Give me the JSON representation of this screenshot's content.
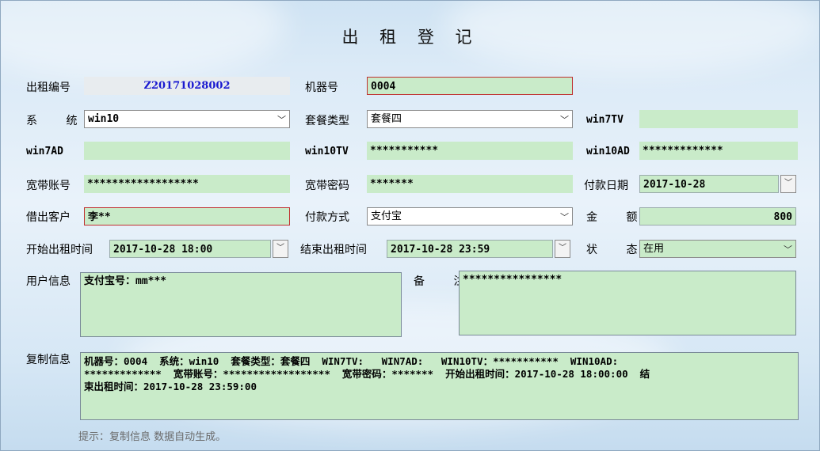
{
  "title": "出 租 登 记",
  "labels": {
    "rental_no": "出租编号",
    "machine_no": "机器号",
    "system": "系 统",
    "package_type": "套餐类型",
    "win7tv": "win7TV",
    "win7ad": "win7AD",
    "win10tv": "win10TV",
    "win10ad": "win10AD",
    "broadband_account": "宽带账号",
    "broadband_password": "宽带密码",
    "payment_date": "付款日期",
    "customer": "借出客户",
    "payment_method": "付款方式",
    "amount": "金 额",
    "start_time": "开始出租时间",
    "end_time": "结束出租时间",
    "status": "状 态",
    "user_info": "用户信息",
    "remark": "备 注",
    "copy_info": "复制信息"
  },
  "values": {
    "rental_no": "Z20171028002",
    "machine_no": "0004",
    "system": "win10",
    "package_type": "套餐四",
    "win7tv": "",
    "win7ad": "",
    "win10tv": "***********",
    "win10ad": "*************",
    "broadband_account": "******************",
    "broadband_password": "*******",
    "payment_date": "2017-10-28",
    "customer": "李**",
    "payment_method": "支付宝",
    "amount": "800",
    "start_time": "2017-10-28 18:00",
    "end_time": "2017-10-28 23:59",
    "status": "在用",
    "user_info": "支付宝号：mm***",
    "remark": "****************",
    "copy_info": "机器号：0004  系统：win10  套餐类型：套餐四  WIN7TV:   WIN7AD:   WIN10TV：***********  WIN10AD:\n*************  宽带账号：******************  宽带密码：*******  开始出租时间：2017-10-28 18:00:00  结\n束出租时间：2017-10-28 23:59:00"
  },
  "hint": "提示：复制信息 数据自动生成。"
}
